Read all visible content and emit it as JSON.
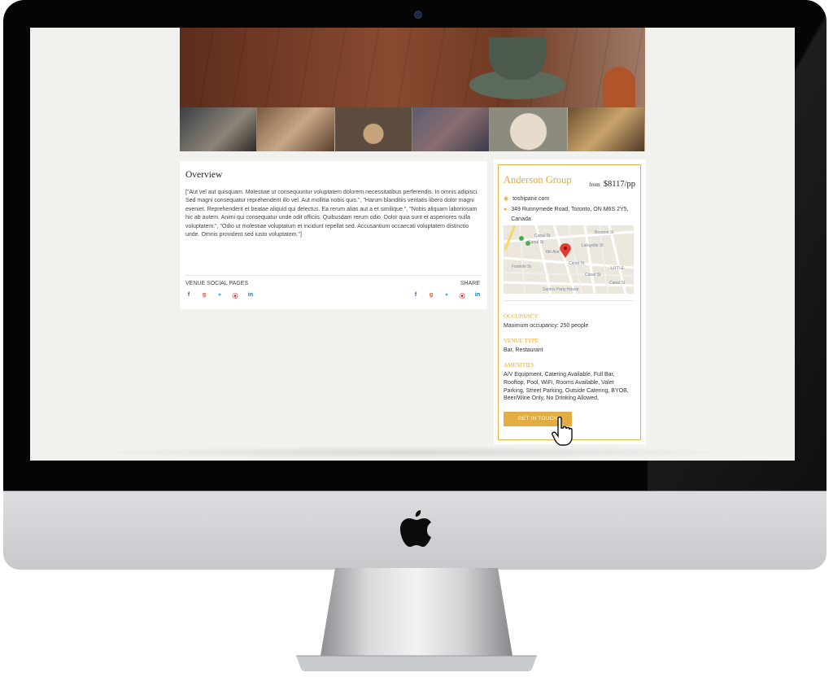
{
  "overview": {
    "title": "Overview",
    "body": "[\"Aut vel aut quisquam. Molestiae ut consequuntur voluptatem dolorem necessitatibus perferendis. In omnis adipisci. Sed magni consequatur reprehenderit illo vel. Aut mollitia nobis quis.\", \"Harum blanditiis veritatis libero dolor magni eveniet. Reprehenderit et beatae aliquid qui delectus. Ea rerum alias aut a et similique.\", \"Nobis aliquam laboriosam hic ab autem. Animi qui consequatur unde odit officiis. Quibusdam rerum odio. Dolor quia sunt et asperiores nulla voluptatem.\", \"Odio ut molestiae voluptatum et incidunt repellat sed. Accusantium occaecati voluptatem distinctio unde. Omnis provident sed iusto voluptatem.\"]",
    "social_label": "VENUE SOCIAL PAGES",
    "share_label": "SHARE",
    "social_icons": [
      "facebook-icon",
      "google-plus-icon",
      "twitter-icon",
      "pinterest-icon",
      "linkedin-icon"
    ]
  },
  "venue": {
    "name": "Anderson Group",
    "price_from": "from",
    "price": "$8117/pp",
    "website": "toshipanir.com",
    "address": "349 Runnymede Road, Toronto, ON M6S 2Y5, Canada",
    "map_labels": {
      "canal_st_1": "Canal St",
      "canal_st_2": "Canal St",
      "canal_st_3": "Canal St",
      "canal_st_4": "Canal St",
      "canal_st_5": "Canal St",
      "franklin_st": "Franklin St",
      "broome_st": "Broome St",
      "lafayette_st": "Lafayette St",
      "little": "LITTLE",
      "santos": "Santos Party House",
      "sixth_ave": "6th Ave"
    },
    "occupancy_label": "OCCUPANCY",
    "occupancy_value": "Maximum occupancy: 250 people",
    "type_label": "VENUE TYPE",
    "type_value": "Bar, Restaurant",
    "amenities_label": "AMENITIES",
    "amenities_value": "A/V Equipment, Catering Available, Full Bar, Rooftop, Pool, WiFi, Rooms Available, Valet Parking, Street Parking, Outside Catering, BYOB, Beer/Wine Only, No Drinking Allowed,",
    "cta_label": "GET IN TOUCH"
  },
  "colors": {
    "accent": "#e3ad43",
    "screen_bg": "#f1f1ee",
    "bezel": "#050505"
  }
}
